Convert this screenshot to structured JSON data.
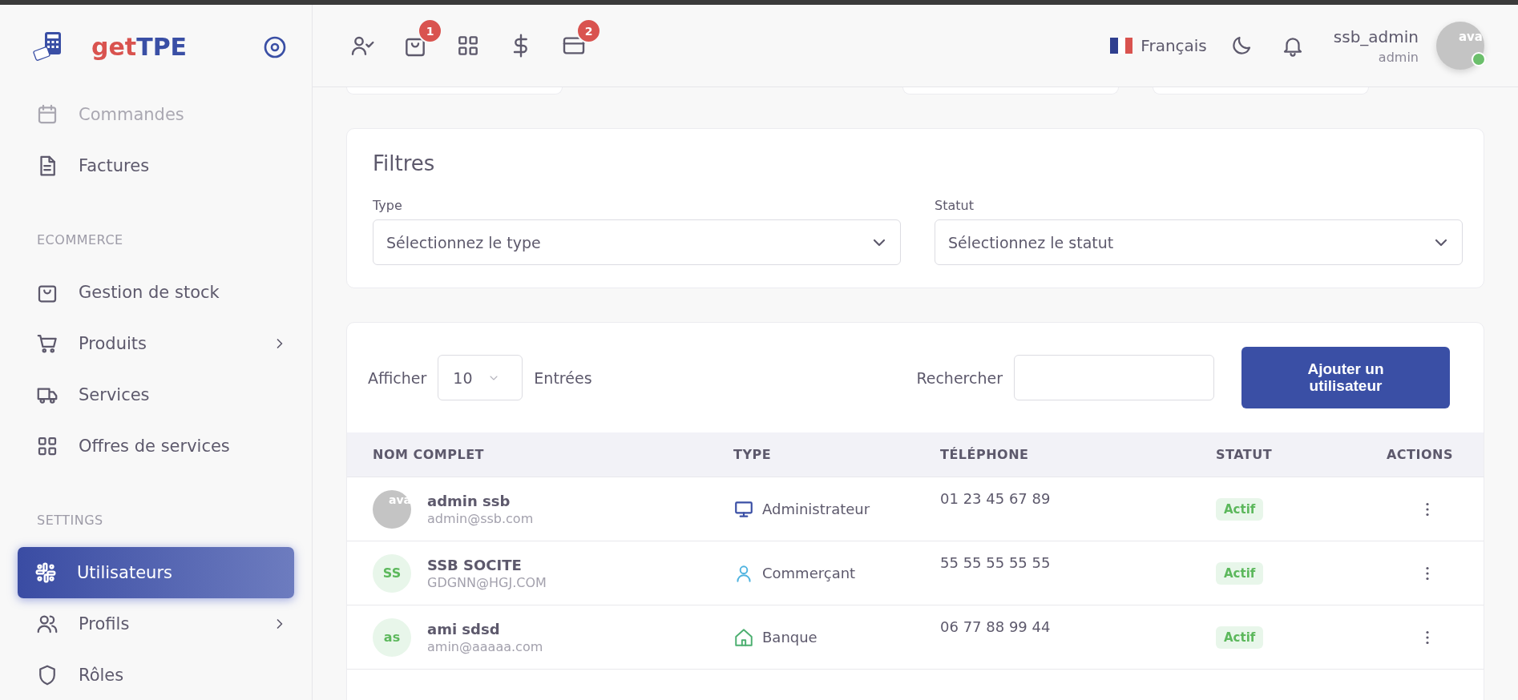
{
  "sidebar": {
    "brand": {
      "first": "get",
      "second": "TPE"
    },
    "items": [
      {
        "kind": "link",
        "label": "Commandes",
        "selected": false,
        "faded": true,
        "submenu": false
      },
      {
        "kind": "link",
        "label": "Factures",
        "selected": false,
        "faded": false,
        "submenu": false
      },
      {
        "kind": "section",
        "label": "ECOMMERCE"
      },
      {
        "kind": "link",
        "label": "Gestion de stock",
        "selected": false,
        "faded": false,
        "submenu": false
      },
      {
        "kind": "link",
        "label": "Produits",
        "selected": false,
        "faded": false,
        "submenu": true
      },
      {
        "kind": "link",
        "label": "Services",
        "selected": false,
        "faded": false,
        "submenu": false
      },
      {
        "kind": "link",
        "label": "Offres de services",
        "selected": false,
        "faded": false,
        "submenu": false
      },
      {
        "kind": "section",
        "label": "SETTINGS"
      },
      {
        "kind": "link",
        "label": "Utilisateurs",
        "selected": true,
        "faded": false,
        "submenu": false
      },
      {
        "kind": "link",
        "label": "Profils",
        "selected": false,
        "faded": false,
        "submenu": true
      },
      {
        "kind": "link",
        "label": "Rôles",
        "selected": false,
        "faded": false,
        "submenu": false
      }
    ]
  },
  "header": {
    "actions": [
      {
        "kind": "plain"
      },
      {
        "kind": "badged",
        "badge": "1"
      },
      {
        "kind": "plain"
      },
      {
        "kind": "plain"
      },
      {
        "kind": "badged",
        "badge": "2"
      }
    ],
    "language": "Français",
    "user": {
      "name": "ssb_admin",
      "role": "admin",
      "avatar_alt": "ava",
      "online": true
    }
  },
  "filters": {
    "title": "Filtres",
    "fields": [
      {
        "label": "Type",
        "placeholder": "Sélectionnez le type"
      },
      {
        "label": "Statut",
        "placeholder": "Sélectionnez le statut"
      }
    ]
  },
  "table": {
    "show_label": "Afficher",
    "page_size": "10",
    "entries_label": "Entrées",
    "search_label": "Rechercher",
    "add_button": "Ajouter un utilisateur",
    "columns": [
      "NOM COMPLET",
      "TYPE",
      "TÉLÉPHONE",
      "STATUT",
      "ACTIONS"
    ],
    "rows": [
      {
        "avatar": {
          "kind": "image",
          "alt": "ava"
        },
        "name": "admin ssb",
        "email": "admin@ssb.com",
        "type": "Administrateur",
        "phone": "01 23 45 67 89",
        "status": "Actif"
      },
      {
        "avatar": {
          "kind": "initials",
          "text": "SS"
        },
        "name": "SSB SOCITE",
        "email": "GDGNN@HGJ.COM",
        "type": "Commerçant",
        "phone": "55 55 55 55 55",
        "status": "Actif"
      },
      {
        "avatar": {
          "kind": "initials",
          "text": "as"
        },
        "name": "ami sdsd",
        "email": "amin@aaaaa.com",
        "type": "Banque",
        "phone": "06 77 88 99 44",
        "status": "Actif"
      }
    ]
  }
}
